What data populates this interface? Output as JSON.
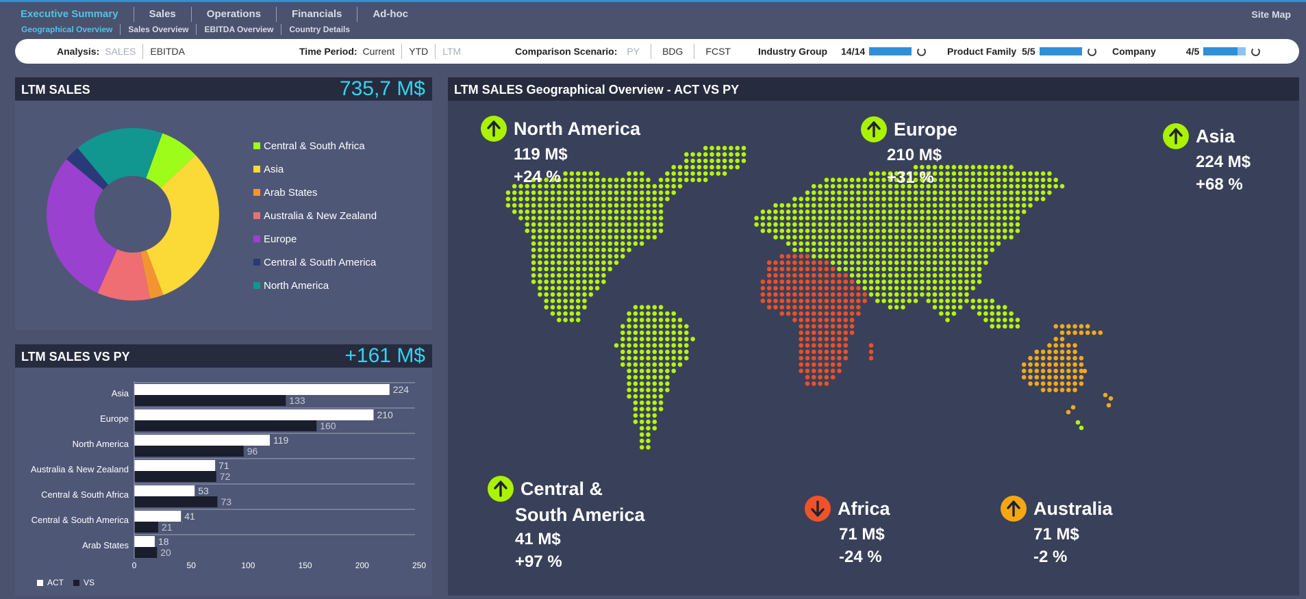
{
  "nav": {
    "main": [
      "Executive Summary",
      "Sales",
      "Operations",
      "Financials",
      "Ad-hoc"
    ],
    "sub": [
      "Geographical Overview",
      "Sales Overview",
      "EBITDA Overview",
      "Country Details"
    ],
    "site_map": "Site Map"
  },
  "filters": {
    "analysis_label": "Analysis:",
    "analysis_options": [
      "SALES",
      "EBITDA"
    ],
    "time_label": "Time Period:",
    "time_options": [
      "Current",
      "YTD",
      "LTM"
    ],
    "comparison_label": "Comparison Scenario:",
    "comparison_options": [
      "PY",
      "BDG",
      "FCST"
    ],
    "industry_label": "Industry Group",
    "industry_count": "14/14",
    "industry_fill": 1.0,
    "product_label": "Product Family",
    "product_count": "5/5",
    "product_fill": 1.0,
    "company_label": "Company",
    "company_count": "4/5",
    "company_fill": 0.8
  },
  "ltm_sales": {
    "title": "LTM SALES",
    "kpi": "735,7 M$"
  },
  "ltm_vs_py": {
    "title": "LTM SALES VS PY",
    "kpi": "+161 M$"
  },
  "map": {
    "title": "LTM SALES Geographical Overview - ACT  VS PY",
    "regions": [
      {
        "name": "North America",
        "value": "119 M$",
        "change": "+24 %",
        "direction": "up",
        "color": "#aaf200"
      },
      {
        "name": "Europe",
        "value": "210 M$",
        "change": "+31 %",
        "direction": "up",
        "color": "#aaf200"
      },
      {
        "name": "Asia",
        "value": "224 M$",
        "change": "+68 %",
        "direction": "up",
        "color": "#aaf200"
      },
      {
        "name": "Central &",
        "name2": "South America",
        "value": "41 M$",
        "change": "+97 %",
        "direction": "up",
        "color": "#aaf200"
      },
      {
        "name": "Africa",
        "value": "71 M$",
        "change": "-24 %",
        "direction": "down",
        "color": "#f0532a"
      },
      {
        "name": "Australia",
        "value": "71 M$",
        "change": "-2 %",
        "direction": "up",
        "color": "#f5a712"
      }
    ]
  },
  "chart_data": [
    {
      "type": "pie",
      "donut": true,
      "title": "LTM SALES",
      "legend_position": "right",
      "labels": [
        "Central & South Africa",
        "Asia",
        "Arab States",
        "Australia & New Zealand",
        "Europe",
        "Central & South America",
        "North America"
      ],
      "colors": [
        "#9efc1a",
        "#fbd936",
        "#f39433",
        "#ef6e73",
        "#9a41cf",
        "#293a78",
        "#119690"
      ],
      "slice_values": [
        53,
        224,
        18,
        71,
        210,
        21,
        119
      ]
    },
    {
      "type": "bar",
      "orientation": "horizontal",
      "title": "LTM SALES VS PY",
      "categories": [
        "Asia",
        "Europe",
        "North America",
        "Australia & New Zealand",
        "Central & South Africa",
        "Central & South America",
        "Arab States"
      ],
      "series": [
        {
          "name": "ACT",
          "color": "#ffffff",
          "values": [
            224,
            210,
            119,
            71,
            53,
            41,
            18
          ]
        },
        {
          "name": "VS",
          "color": "#1a1d2c",
          "values": [
            133,
            160,
            96,
            72,
            73,
            21,
            20
          ]
        }
      ],
      "xlim": [
        0,
        250
      ],
      "xticks": [
        0,
        50,
        100,
        150,
        200,
        250
      ]
    }
  ]
}
